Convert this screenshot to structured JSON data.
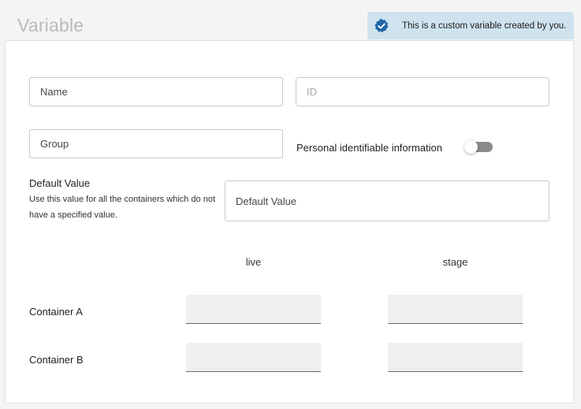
{
  "header": {
    "title": "Variable"
  },
  "banner": {
    "icon": "verified-badge-icon",
    "text": "This is a custom variable created by you.",
    "background": "#cfe3ef",
    "icon_color": "#1f64a8"
  },
  "form": {
    "name_placeholder": "Name",
    "id_placeholder": "ID",
    "group_placeholder": "Group",
    "pii_label": "Personal identifiable information",
    "pii_enabled": false,
    "default_value": {
      "title": "Default Value",
      "description": "Use this value for all the containers which do not have a specified value.",
      "placeholder": "Default Value"
    }
  },
  "containers": {
    "columns": [
      "live",
      "stage"
    ],
    "rows": [
      {
        "label": "Container A",
        "values": [
          "",
          ""
        ]
      },
      {
        "label": "Container B",
        "values": [
          "",
          ""
        ]
      }
    ]
  }
}
